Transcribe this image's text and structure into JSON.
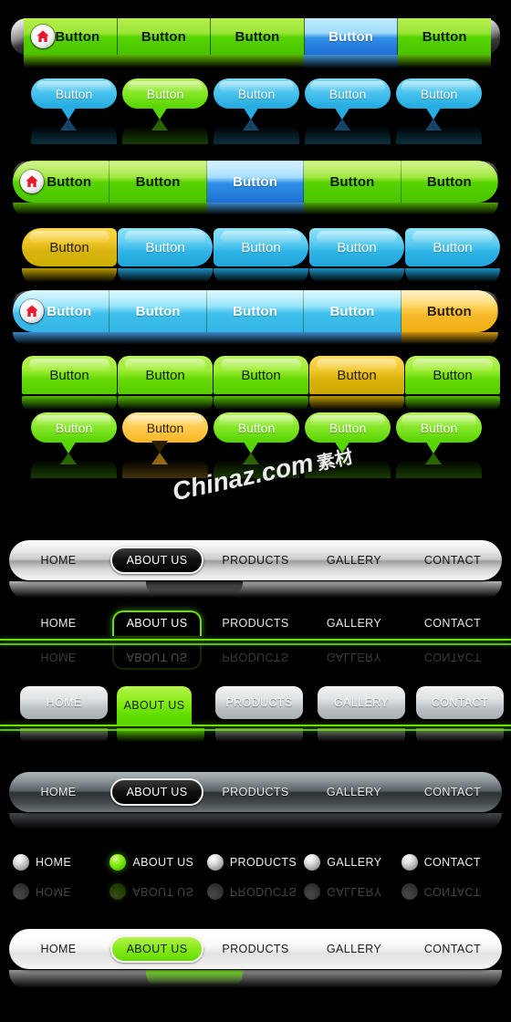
{
  "meta": {
    "watermark": "Chinaz.com",
    "watermark_cn": "素材",
    "button_label": "Button"
  },
  "colors": {
    "green": "#63dd00",
    "light_green": "#9ce639",
    "blue": "#2f8fe8",
    "cyan": "#31b3e4",
    "yellow": "#d8b410",
    "amber": "#f7b92a",
    "silver": "#c9c9c9",
    "background": "#000000"
  },
  "rows": [
    {
      "id": "segmented-green-bar",
      "style": "segmented bar with chrome end caps",
      "home_icon": "home-icon",
      "items": [
        {
          "label": "Button",
          "state": "normal",
          "color": "green"
        },
        {
          "label": "Button",
          "state": "normal",
          "color": "green"
        },
        {
          "label": "Button",
          "state": "normal",
          "color": "green"
        },
        {
          "label": "Button",
          "state": "active",
          "color": "blue"
        },
        {
          "label": "Button",
          "state": "normal",
          "color": "green"
        }
      ]
    },
    {
      "id": "speech-bubble-row-blue",
      "style": "speech bubble buttons",
      "items": [
        {
          "label": "Button",
          "state": "normal",
          "color": "blue"
        },
        {
          "label": "Button",
          "state": "active",
          "color": "green"
        },
        {
          "label": "Button",
          "state": "normal",
          "color": "blue"
        },
        {
          "label": "Button",
          "state": "normal",
          "color": "blue"
        },
        {
          "label": "Button",
          "state": "normal",
          "color": "blue"
        }
      ]
    },
    {
      "id": "rounded-green-pill-bar",
      "style": "rounded pill bar",
      "home_icon": "home-icon",
      "items": [
        {
          "label": "Button",
          "state": "normal",
          "color": "green"
        },
        {
          "label": "Button",
          "state": "normal",
          "color": "green"
        },
        {
          "label": "Button",
          "state": "active",
          "color": "blue"
        },
        {
          "label": "Button",
          "state": "normal",
          "color": "green"
        },
        {
          "label": "Button",
          "state": "normal",
          "color": "green"
        }
      ]
    },
    {
      "id": "separate-pill-buttons",
      "style": "individual pill buttons",
      "items": [
        {
          "label": "Button",
          "state": "active",
          "color": "yellow"
        },
        {
          "label": "Button",
          "state": "normal",
          "color": "cyan"
        },
        {
          "label": "Button",
          "state": "normal",
          "color": "cyan"
        },
        {
          "label": "Button",
          "state": "normal",
          "color": "cyan"
        },
        {
          "label": "Button",
          "state": "normal",
          "color": "cyan"
        }
      ]
    },
    {
      "id": "cyan-pill-bar",
      "style": "rounded pill bar",
      "home_icon": "home-icon",
      "items": [
        {
          "label": "Button",
          "state": "normal",
          "color": "cyan"
        },
        {
          "label": "Button",
          "state": "normal",
          "color": "cyan"
        },
        {
          "label": "Button",
          "state": "normal",
          "color": "cyan"
        },
        {
          "label": "Button",
          "state": "normal",
          "color": "cyan"
        },
        {
          "label": "Button",
          "state": "active",
          "color": "amber"
        }
      ]
    },
    {
      "id": "tab-style-buttons",
      "style": "tab buttons flat bottom",
      "items": [
        {
          "label": "Button",
          "state": "normal",
          "color": "green"
        },
        {
          "label": "Button",
          "state": "normal",
          "color": "green"
        },
        {
          "label": "Button",
          "state": "normal",
          "color": "green"
        },
        {
          "label": "Button",
          "state": "active",
          "color": "gold"
        },
        {
          "label": "Button",
          "state": "normal",
          "color": "green"
        }
      ]
    },
    {
      "id": "speech-bubble-row-green",
      "style": "speech bubble buttons",
      "items": [
        {
          "label": "Button",
          "state": "normal",
          "color": "green"
        },
        {
          "label": "Button",
          "state": "active",
          "color": "amber"
        },
        {
          "label": "Button",
          "state": "normal",
          "color": "green"
        },
        {
          "label": "Button",
          "state": "normal",
          "color": "green"
        },
        {
          "label": "Button",
          "state": "normal",
          "color": "green"
        }
      ]
    }
  ],
  "navbars": [
    {
      "id": "chrome-silver-navbar",
      "style": "chrome silver bar with dark active pill",
      "items": [
        {
          "label": "HOME",
          "state": "normal"
        },
        {
          "label": "ABOUT US",
          "state": "active"
        },
        {
          "label": "PRODUCTS",
          "state": "normal"
        },
        {
          "label": "GALLERY",
          "state": "normal"
        },
        {
          "label": "CONTACT",
          "state": "normal"
        }
      ]
    },
    {
      "id": "green-underline-navbar",
      "style": "transparent nav with green rule and outlined active tab",
      "items": [
        {
          "label": "HOME",
          "state": "normal"
        },
        {
          "label": "ABOUT US",
          "state": "active"
        },
        {
          "label": "PRODUCTS",
          "state": "normal"
        },
        {
          "label": "GALLERY",
          "state": "normal"
        },
        {
          "label": "CONTACT",
          "state": "normal"
        }
      ]
    },
    {
      "id": "silver-tab-navbar",
      "style": "separate silver tabs with green active tab and green rule",
      "items": [
        {
          "label": "HOME",
          "state": "normal"
        },
        {
          "label": "ABOUT US",
          "state": "active"
        },
        {
          "label": "PRODUCTS",
          "state": "normal"
        },
        {
          "label": "GALLERY",
          "state": "normal"
        },
        {
          "label": "CONTACT",
          "state": "normal"
        }
      ]
    },
    {
      "id": "dark-gray-navbar",
      "style": "dark gray glossy bar with dark active pill",
      "items": [
        {
          "label": "HOME",
          "state": "normal"
        },
        {
          "label": "ABOUT US",
          "state": "active"
        },
        {
          "label": "PRODUCTS",
          "state": "normal"
        },
        {
          "label": "GALLERY",
          "state": "normal"
        },
        {
          "label": "CONTACT",
          "state": "normal"
        }
      ]
    },
    {
      "id": "sphere-bullet-navbar",
      "style": "glossy sphere bullets with labels",
      "items": [
        {
          "label": "HOME",
          "state": "normal"
        },
        {
          "label": "ABOUT US",
          "state": "active"
        },
        {
          "label": "PRODUCTS",
          "state": "normal"
        },
        {
          "label": "GALLERY",
          "state": "normal"
        },
        {
          "label": "CONTACT",
          "state": "normal"
        }
      ]
    },
    {
      "id": "white-navbar",
      "style": "white bar with green active pill",
      "items": [
        {
          "label": "HOME",
          "state": "normal"
        },
        {
          "label": "ABOUT US",
          "state": "active"
        },
        {
          "label": "PRODUCTS",
          "state": "normal"
        },
        {
          "label": "GALLERY",
          "state": "normal"
        },
        {
          "label": "CONTACT",
          "state": "normal"
        }
      ]
    }
  ]
}
